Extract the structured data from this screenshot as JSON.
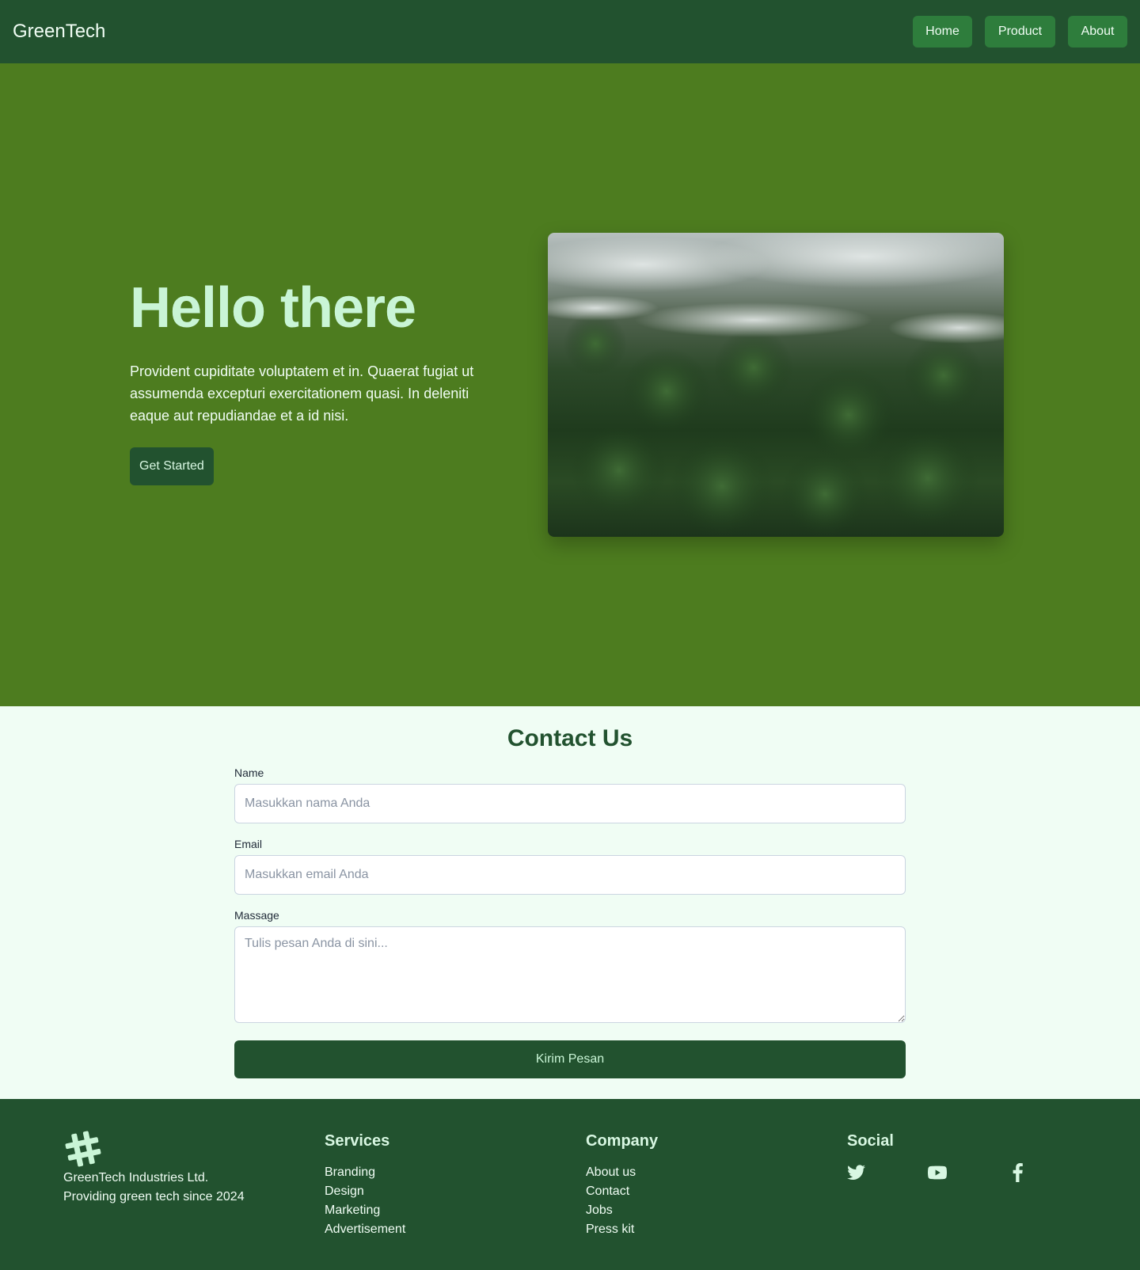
{
  "navbar": {
    "brand": "GreenTech",
    "links": [
      "Home",
      "Product",
      "About"
    ]
  },
  "hero": {
    "title": "Hello there",
    "description": "Provident cupiditate voluptatem et in. Quaerat fugiat ut assumenda excepturi exercitationem quasi. In deleniti eaque aut repudiandae et a id nisi.",
    "cta_label": "Get Started",
    "image_subject": "misty forest canopy aerial photo"
  },
  "contact": {
    "title": "Contact Us",
    "name_label": "Name",
    "name_placeholder": "Masukkan nama Anda",
    "email_label": "Email",
    "email_placeholder": "Masukkan email Anda",
    "message_label": "Massage",
    "message_placeholder": "Tulis pesan Anda di sini...",
    "submit_label": "Kirim Pesan"
  },
  "footer": {
    "logo_icon": "hash-icon",
    "company_name": "GreenTech Industries Ltd.",
    "tagline": "Providing green tech since 2024",
    "services": {
      "heading": "Services",
      "items": [
        "Branding",
        "Design",
        "Marketing",
        "Advertisement"
      ]
    },
    "company": {
      "heading": "Company",
      "items": [
        "About us",
        "Contact",
        "Jobs",
        "Press kit"
      ]
    },
    "social": {
      "heading": "Social",
      "icons": [
        "twitter-icon",
        "youtube-icon",
        "facebook-icon"
      ]
    }
  },
  "colors": {
    "navbar_bg": "#22522f",
    "hero_bg": "#4d7c1f",
    "accent_light": "#c9f5d6",
    "contact_bg": "#f0fdf4",
    "nav_button_bg": "#2e7d3c"
  }
}
